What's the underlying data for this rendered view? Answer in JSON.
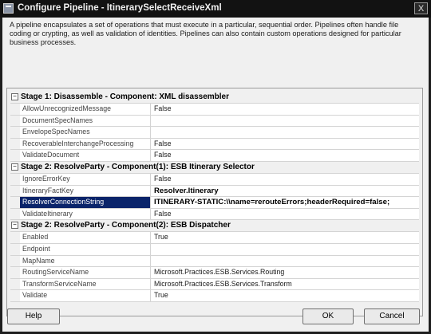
{
  "window": {
    "title": "Configure Pipeline - ItinerarySelectReceiveXml",
    "close_glyph": "X"
  },
  "description": "A pipeline encapsulates a set of operations that must execute in a particular, sequential order. Pipelines often handle file coding or crypting, as well as validation of identities. Pipelines can also contain custom operations designed for particular business processes.",
  "stages": [
    {
      "label": "Stage 1: Disassemble - Component: XML disassembler",
      "toggle": "−",
      "properties": [
        {
          "name": "AllowUnrecognizedMessage",
          "value": "False"
        },
        {
          "name": "DocumentSpecNames",
          "value": ""
        },
        {
          "name": "EnvelopeSpecNames",
          "value": ""
        },
        {
          "name": "RecoverableInterchangeProcessing",
          "value": "False"
        },
        {
          "name": "ValidateDocument",
          "value": "False"
        }
      ]
    },
    {
      "label": "Stage 2: ResolveParty - Component(1): ESB Itinerary Selector",
      "toggle": "−",
      "properties": [
        {
          "name": "IgnoreErrorKey",
          "value": "False"
        },
        {
          "name": "ItineraryFactKey",
          "value": "Resolver.Itinerary"
        },
        {
          "name": "ResolverConnectionString",
          "value": "ITINERARY-STATIC:\\\\name=rerouteErrors;headerRequired=false;"
        },
        {
          "name": "ValidateItinerary",
          "value": "False"
        }
      ]
    },
    {
      "label": "Stage 2: ResolveParty - Component(2): ESB Dispatcher",
      "toggle": "−",
      "properties": [
        {
          "name": "Enabled",
          "value": "True"
        },
        {
          "name": "Endpoint",
          "value": ""
        },
        {
          "name": "MapName",
          "value": ""
        },
        {
          "name": "RoutingServiceName",
          "value": "Microsoft.Practices.ESB.Services.Routing"
        },
        {
          "name": "TransformServiceName",
          "value": "Microsoft.Practices.ESB.Services.Transform"
        },
        {
          "name": "Validate",
          "value": "True"
        }
      ]
    }
  ],
  "buttons": {
    "help": "Help",
    "ok": "OK",
    "cancel": "Cancel"
  },
  "colors": {
    "selection": "#0a246a",
    "titlebar": "#121212",
    "dialog_face": "#f0f0f0"
  }
}
